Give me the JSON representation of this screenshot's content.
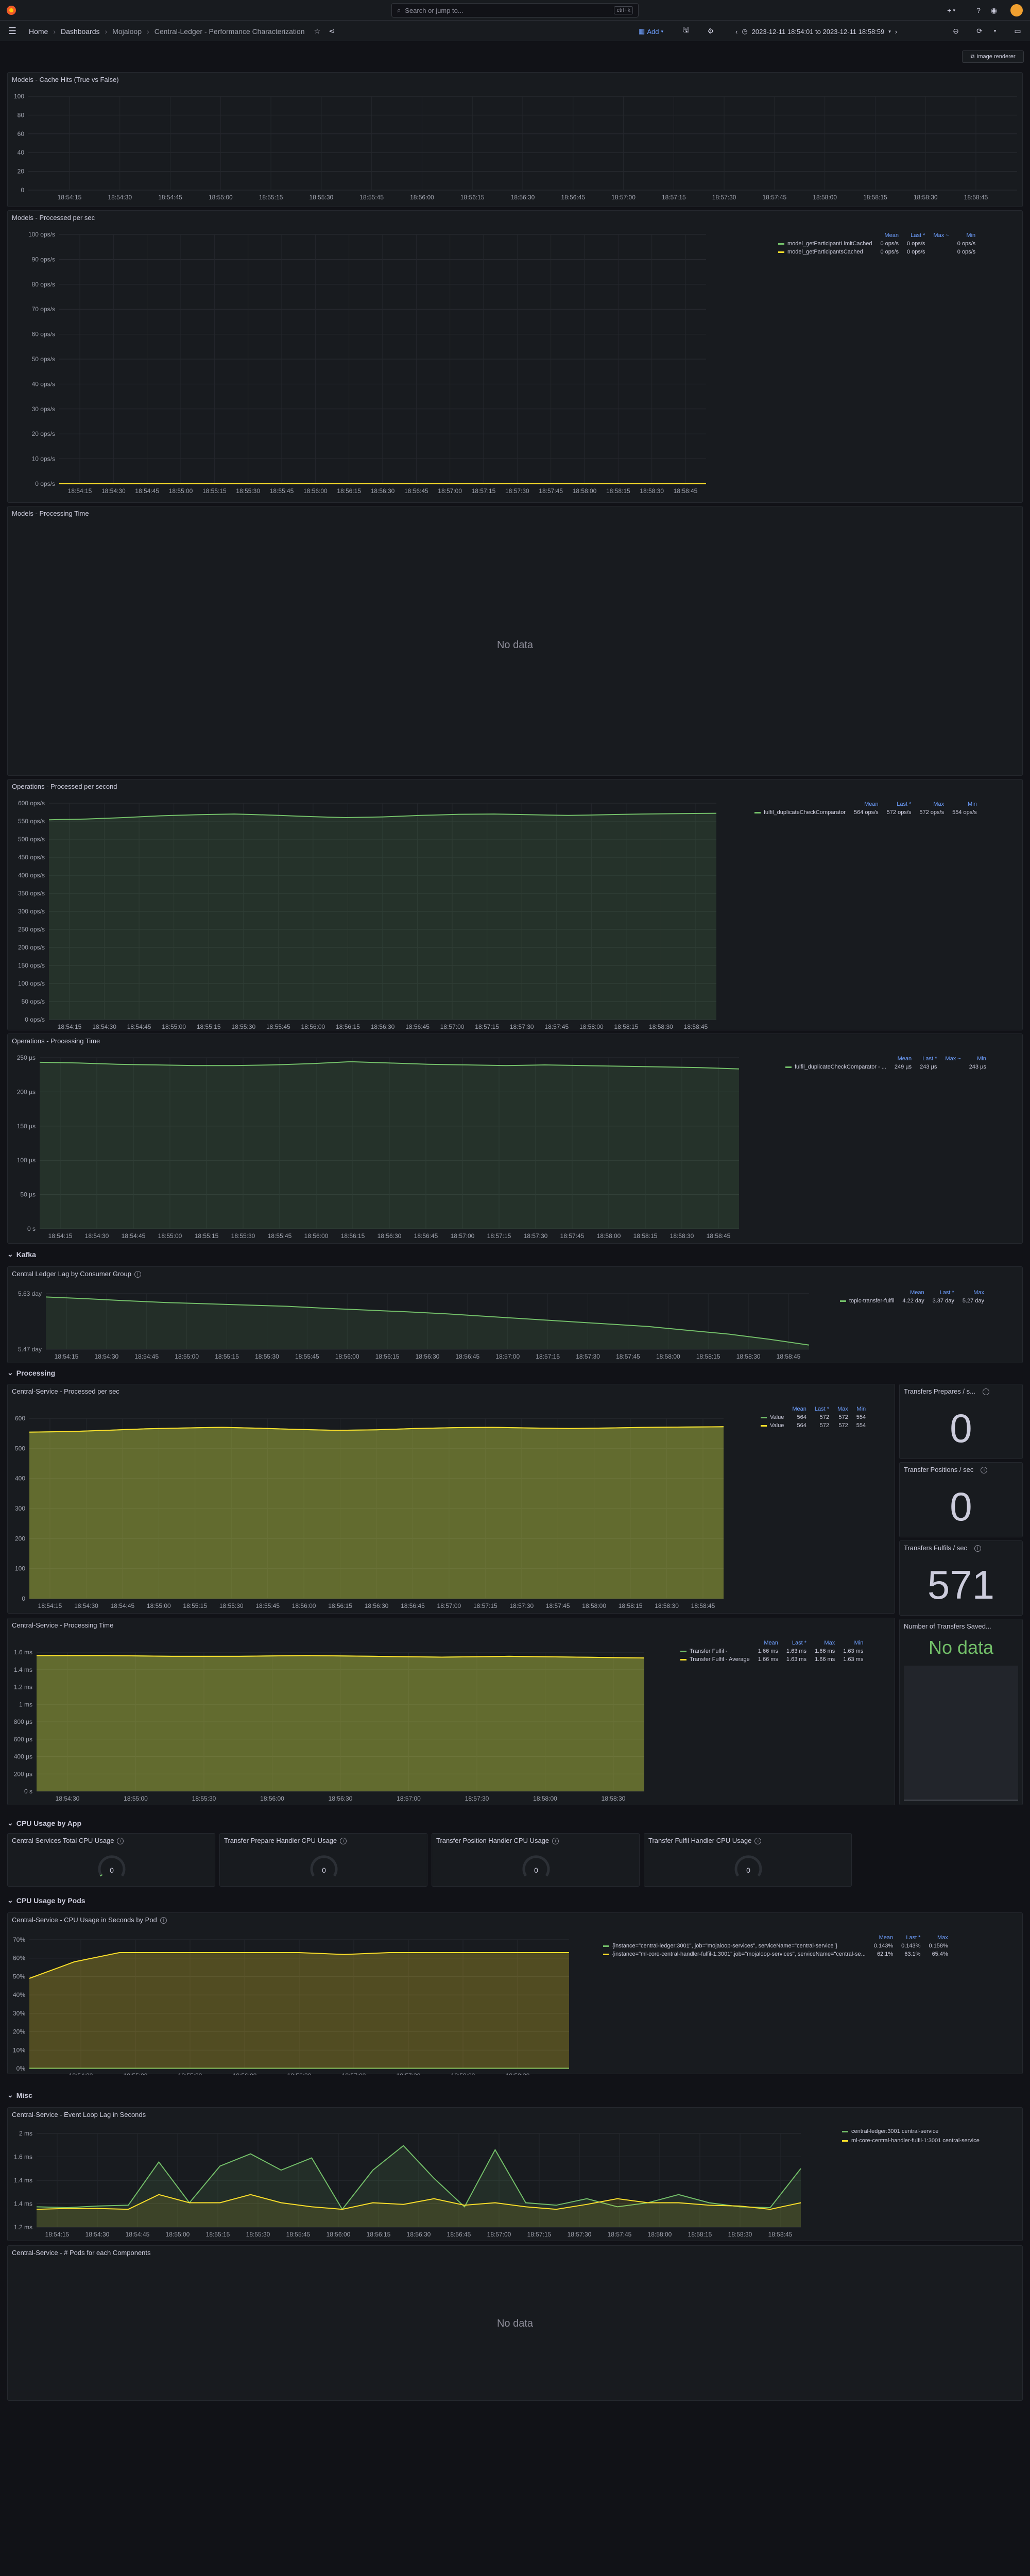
{
  "topbar": {
    "search_placeholder": "Search or jump to...",
    "search_kbd": "ctrl+k",
    "plus_label": "+",
    "new_label": "New"
  },
  "breadcrumb": {
    "home": "Home",
    "dashboards": "Dashboards",
    "folder": "Mojaloop",
    "title": "Central-Ledger - Performance Characterization"
  },
  "toolbar": {
    "add_label": "Add",
    "time_range": "2023-12-11 18:54:01 to 2023-12-11 18:58:59",
    "image_renderer": "Image renderer"
  },
  "x_ticks_a": [
    "18:54:15",
    "18:54:30",
    "18:54:45",
    "18:55:00",
    "18:55:15",
    "18:55:30",
    "18:55:45",
    "18:56:00",
    "18:56:15",
    "18:56:30",
    "18:56:45",
    "18:57:00",
    "18:57:15",
    "18:57:30",
    "18:57:45",
    "18:58:00",
    "18:58:15",
    "18:58:30",
    "18:58:45"
  ],
  "x_ticks_b": [
    "18:54:30",
    "18:55:00",
    "18:55:30",
    "18:56:00",
    "18:56:30",
    "18:57:00",
    "18:57:30",
    "18:58:00",
    "18:58:30"
  ],
  "x_ticks_c": [
    "18:54:30",
    "18:55:00",
    "18:55:30",
    "18:56:00",
    "18:56:30",
    "18:57:00",
    "18:57:30",
    "18:58:00",
    "18:58:30"
  ],
  "legend_headers": {
    "mean": "Mean",
    "last": "Last *",
    "max": "Max",
    "min": "Min",
    "max_sort": "Max ~"
  },
  "panels": {
    "cache_hits": {
      "title": "Models - Cache Hits (True vs False)",
      "y_ticks": [
        "100",
        "80",
        "60",
        "40",
        "20",
        "0"
      ]
    },
    "processed_sec": {
      "title": "Models - Processed per sec",
      "y_ticks": [
        "100 ops/s",
        "90 ops/s",
        "80 ops/s",
        "70 ops/s",
        "60 ops/s",
        "50 ops/s",
        "40 ops/s",
        "30 ops/s",
        "20 ops/s",
        "10 ops/s",
        "0 ops/s"
      ],
      "legend": [
        {
          "name": "model_getParticipantLimitCached",
          "color": "#73bf69",
          "mean": "0 ops/s",
          "last": "0 ops/s",
          "max": "0 ops/s",
          "min": "0 ops/s"
        },
        {
          "name": "model_getParticipantsCached",
          "color": "#fade2a",
          "mean": "0 ops/s",
          "last": "0 ops/s",
          "max": "0 ops/s",
          "min": "0 ops/s"
        }
      ]
    },
    "proc_time": {
      "title": "Models - Processing Time",
      "no_data": "No data"
    },
    "ops_sec": {
      "title": "Operations - Processed per second",
      "y_ticks": [
        "600 ops/s",
        "550 ops/s",
        "500 ops/s",
        "450 ops/s",
        "400 ops/s",
        "350 ops/s",
        "300 ops/s",
        "250 ops/s",
        "200 ops/s",
        "150 ops/s",
        "100 ops/s",
        "50 ops/s",
        "0 ops/s"
      ],
      "legend": [
        {
          "name": "fulfil_duplicateCheckComparator",
          "color": "#73bf69",
          "mean": "564 ops/s",
          "last": "572 ops/s",
          "max": "572 ops/s",
          "min": "554 ops/s"
        }
      ]
    },
    "ops_time": {
      "title": "Operations - Processing Time",
      "y_ticks": [
        "250 µs",
        "200 µs",
        "150 µs",
        "100 µs",
        "50 µs",
        "0 s"
      ],
      "legend": [
        {
          "name": "fulfil_duplicateCheckComparator - ...",
          "color": "#73bf69",
          "mean": "249 µs",
          "last": "243 µs",
          "max": "256 µs",
          "min": "243 µs"
        }
      ]
    },
    "lag": {
      "title": "Central Ledger Lag by Consumer Group",
      "y_ticks": [
        "5.63 day",
        "5.47 day"
      ],
      "legend": [
        {
          "name": "topic-transfer-fulfil",
          "color": "#73bf69",
          "mean": "4.22 day",
          "last": "3.37 day",
          "max": "5.27 day"
        }
      ]
    },
    "cs_proc_sec": {
      "title": "Central-Service - Processed per sec",
      "y_ticks": [
        "600",
        "500",
        "400",
        "300",
        "200",
        "100",
        "0"
      ],
      "legend": [
        {
          "name": "Value",
          "color": "#73bf69",
          "mean": "564",
          "last": "572",
          "max": "572",
          "min": "554"
        },
        {
          "name": "Value",
          "color": "#fade2a",
          "mean": "564",
          "last": "572",
          "max": "572",
          "min": "554"
        }
      ]
    },
    "cs_proc_time": {
      "title": "Central-Service - Processing Time",
      "y_ticks": [
        "1.6 ms",
        "1.4 ms",
        "1.2 ms",
        "1 ms",
        "800 µs",
        "600 µs",
        "400 µs",
        "200 µs",
        "0 s"
      ],
      "legend": [
        {
          "name": "Transfer Fulfil -",
          "color": "#73bf69",
          "mean": "1.66 ms",
          "last": "1.63 ms",
          "max": "1.66 ms",
          "min": "1.63 ms"
        },
        {
          "name": "Transfer Fulfil - Average",
          "color": "#fade2a",
          "mean": "1.66 ms",
          "last": "1.63 ms",
          "max": "1.66 ms",
          "min": "1.63 ms"
        }
      ]
    },
    "stat_prepares": {
      "title": "Transfers Prepares / s...",
      "value": "0"
    },
    "stat_positions": {
      "title": "Transfer Positions / sec",
      "value": "0"
    },
    "stat_fulfils": {
      "title": "Transfers Fulfils / sec",
      "value": "571"
    },
    "stat_saved": {
      "title": "Number of Transfers Saved...",
      "value": "No data"
    },
    "cpu_total": {
      "title": "Central Services Total CPU Usage",
      "value": "0"
    },
    "cpu_prepare": {
      "title": "Transfer Prepare Handler CPU Usage",
      "value": "0"
    },
    "cpu_position": {
      "title": "Transfer Position Handler CPU Usage",
      "value": "0"
    },
    "cpu_fulfil": {
      "title": "Transfer Fulfil Handler CPU Usage",
      "value": "0"
    },
    "cpu_pods": {
      "title": "Central-Service - CPU Usage in Seconds by Pod",
      "y_ticks": [
        "70%",
        "60%",
        "50%",
        "40%",
        "30%",
        "20%",
        "10%",
        "0%"
      ],
      "legend": [
        {
          "name": "{instance=\"central-ledger:3001\", job=\"mojaloop-services\", serviceName=\"central-service\"}",
          "color": "#73bf69",
          "mean": "0.143%",
          "last": "0.143%",
          "max": "0.158%"
        },
        {
          "name": "{instance=\"ml-core-central-handler-fulfil-1:3001\",job=\"mojaloop-services\", serviceName=\"central-se...",
          "color": "#fade2a",
          "mean": "62.1%",
          "last": "63.1%",
          "max": "65.4%"
        }
      ]
    },
    "event_loop": {
      "title": "Central-Service - Event Loop Lag in Seconds",
      "y_ticks": [
        "2 ms",
        "1.6 ms",
        "1.4 ms",
        "1.4 ms",
        "1.2 ms"
      ],
      "legend": [
        {
          "name": "central-ledger:3001 central-service",
          "color": "#73bf69"
        },
        {
          "name": "ml-core-central-handler-fulfil-1:3001 central-service",
          "color": "#fade2a"
        }
      ]
    },
    "pods_comp": {
      "title": "Central-Service - # Pods for each Components",
      "no_data": "No data"
    }
  },
  "rows": {
    "kafka": "Kafka",
    "processing": "Processing",
    "cpu_app": "CPU Usage by App",
    "cpu_pods": "CPU Usage by Pods",
    "misc": "Misc"
  },
  "chart_data": [
    {
      "type": "line",
      "title": "Models - Cache Hits (True vs False)",
      "ylim": [
        0,
        100
      ],
      "series": []
    },
    {
      "type": "line",
      "title": "Models - Processed per sec",
      "ylim": [
        0,
        100
      ],
      "series": [
        {
          "name": "model_getParticipantLimitCached",
          "values": [
            0,
            0
          ]
        },
        {
          "name": "model_getParticipantsCached",
          "values": [
            0,
            0
          ]
        }
      ]
    },
    {
      "type": "area",
      "title": "Operations - Processed per second",
      "ylim": [
        0,
        600
      ],
      "series": [
        {
          "name": "fulfil_duplicateCheckComparator",
          "values": [
            554,
            556,
            560,
            565,
            568,
            570,
            567,
            563,
            560,
            562,
            566,
            569,
            570,
            568,
            566,
            568,
            570,
            571,
            572
          ]
        }
      ]
    },
    {
      "type": "area",
      "title": "Operations - Processing Time",
      "ylim": [
        0,
        260
      ],
      "series": [
        {
          "name": "fulfil_duplicateCheckComparator - ...",
          "values": [
            253,
            252,
            250,
            249,
            248,
            248,
            249,
            251,
            254,
            252,
            250,
            249,
            248,
            249,
            248,
            247,
            246,
            245,
            243
          ]
        }
      ]
    },
    {
      "type": "area",
      "title": "Central Ledger Lag by Consumer Group",
      "series": [
        {
          "name": "topic-transfer-fulfil",
          "values": [
            5.27,
            5.2,
            5.12,
            5.05,
            5.0,
            4.95,
            4.9,
            4.82,
            4.75,
            4.68,
            4.6,
            4.5,
            4.4,
            4.3,
            4.2,
            4.1,
            3.95,
            3.8,
            3.6,
            3.37
          ]
        }
      ]
    },
    {
      "type": "area",
      "title": "Central-Service - Processed per sec",
      "ylim": [
        0,
        650
      ],
      "series": [
        {
          "name": "Value",
          "values": [
            554,
            556,
            560,
            565,
            568,
            570,
            567,
            563,
            560,
            562,
            566,
            569,
            570,
            568,
            566,
            568,
            570,
            571,
            572
          ]
        },
        {
          "name": "Value",
          "values": [
            554,
            556,
            560,
            565,
            568,
            570,
            567,
            563,
            560,
            562,
            566,
            569,
            570,
            568,
            566,
            568,
            570,
            571,
            572
          ]
        }
      ]
    },
    {
      "type": "area",
      "title": "Central-Service - Processing Time",
      "series": [
        {
          "name": "Transfer Fulfil -",
          "values": [
            1.66,
            1.66,
            1.65,
            1.65,
            1.66,
            1.65,
            1.64,
            1.65,
            1.64,
            1.63
          ]
        },
        {
          "name": "Transfer Fulfil - Average",
          "values": [
            1.66,
            1.66,
            1.65,
            1.65,
            1.66,
            1.65,
            1.64,
            1.65,
            1.64,
            1.63
          ]
        }
      ]
    },
    {
      "type": "area",
      "title": "Central-Service - CPU Usage in Seconds by Pod",
      "ylim": [
        0,
        70
      ],
      "series": [
        {
          "name": "central-ledger:3001",
          "values": [
            0.14,
            0.14,
            0.14,
            0.15,
            0.14,
            0.14,
            0.14,
            0.14,
            0.14,
            0.14
          ]
        },
        {
          "name": "ml-core-central-handler-fulfil-1:3001",
          "values": [
            49,
            58,
            63,
            63,
            63,
            63,
            63,
            62,
            63,
            63,
            63,
            63,
            63
          ]
        }
      ]
    },
    {
      "type": "area",
      "title": "Central-Service - Event Loop Lag in Seconds",
      "series": [
        {
          "name": "central-ledger:3001 central-service",
          "values": [
            1.25,
            1.24,
            1.26,
            1.27,
            1.8,
            1.3,
            1.75,
            1.9,
            1.7,
            1.85,
            1.22,
            1.7,
            2.0,
            1.6,
            1.25,
            1.95,
            1.3,
            1.27,
            1.35,
            1.25,
            1.3,
            1.4,
            1.3,
            1.25,
            1.24,
            1.72
          ]
        },
        {
          "name": "ml-core-central-handler-fulfil-1:3001 central-service",
          "values": [
            1.22,
            1.23,
            1.23,
            1.22,
            1.4,
            1.3,
            1.3,
            1.4,
            1.3,
            1.25,
            1.22,
            1.3,
            1.28,
            1.35,
            1.27,
            1.3,
            1.25,
            1.22,
            1.28,
            1.35,
            1.3,
            1.3,
            1.27,
            1.26,
            1.22,
            1.3
          ]
        }
      ]
    }
  ]
}
